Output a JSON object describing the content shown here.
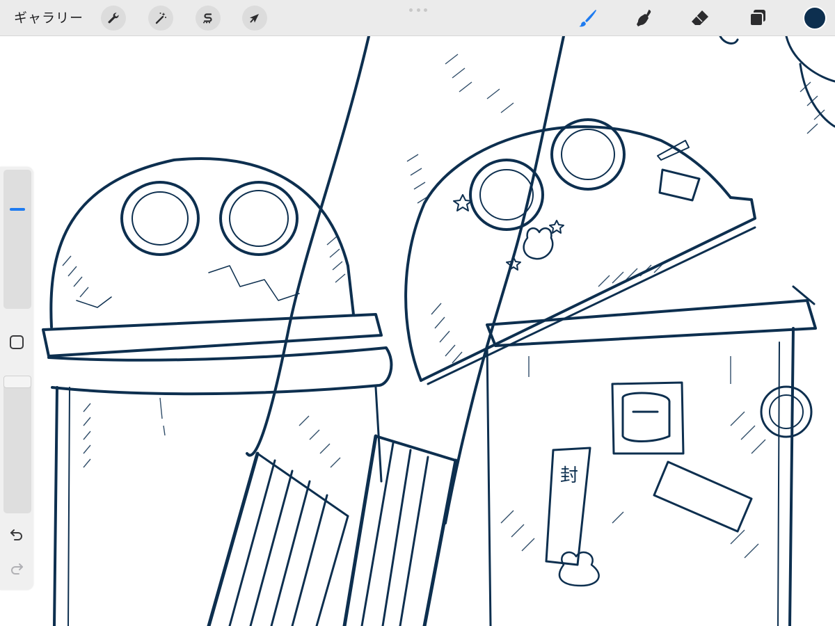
{
  "toolbar": {
    "gallery_label": "ギャラリー",
    "left_tools": [
      {
        "icon": "wrench-icon",
        "name": "actions"
      },
      {
        "icon": "magic-wand-icon",
        "name": "adjustments"
      },
      {
        "icon": "selection-s-icon",
        "name": "selection"
      },
      {
        "icon": "arrow-cursor-icon",
        "name": "transform"
      }
    ],
    "right_tools": [
      {
        "icon": "brush-icon",
        "name": "paint",
        "active": true
      },
      {
        "icon": "smudge-finger-icon",
        "name": "smudge",
        "active": false
      },
      {
        "icon": "eraser-icon",
        "name": "eraser",
        "active": false
      },
      {
        "icon": "layers-icon",
        "name": "layers",
        "active": false
      }
    ],
    "current_color": "#0d2f4f"
  },
  "sidebar": {
    "brush_size": 0.72,
    "brush_opacity": 1.0,
    "modify_button_icon": "square-icon",
    "undo_icon": "undo-arrow-icon",
    "redo_icon": "redo-arrow-icon"
  },
  "colors": {
    "ink": "#0d2f4f",
    "active_tool": "#1e7bf0",
    "toolbar_bg": "#ebebeb",
    "icon_dark": "#2c2c2e"
  },
  "canvas": {
    "content": "line-art-sketch-trash-cans"
  }
}
